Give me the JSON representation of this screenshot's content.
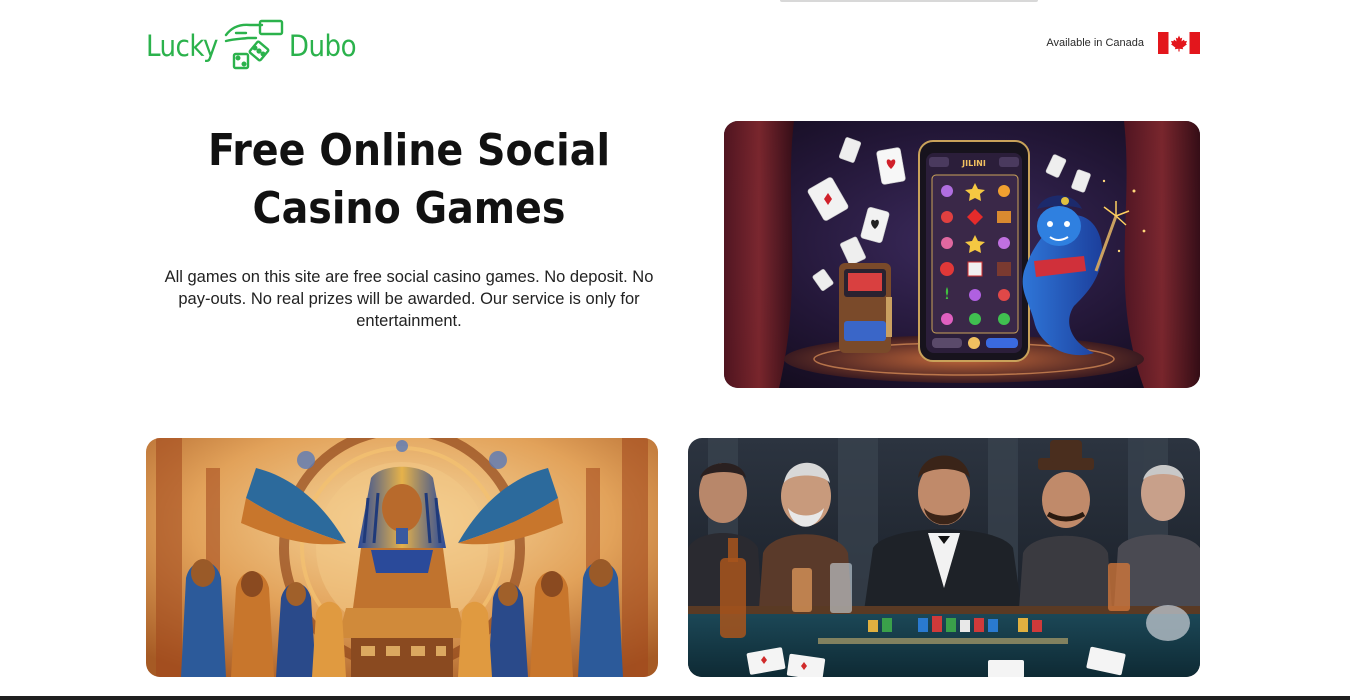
{
  "header": {
    "logo": {
      "word1": "Lucky",
      "word2": "Dubo"
    },
    "availability_text": "Available in Canada",
    "flag_icon": "canada-flag-icon"
  },
  "hero": {
    "title": "Free Online Social Casino Games",
    "description": "All games on this site are free social casino games. No deposit. No pay-outs. No real prizes will be awarded. Our service is only for entertainment."
  },
  "images": {
    "hero": {
      "screen_title": "JILINI"
    }
  },
  "colors": {
    "brand_green": "#2bb24c",
    "text": "#111111",
    "flag_red": "#e3161c"
  }
}
